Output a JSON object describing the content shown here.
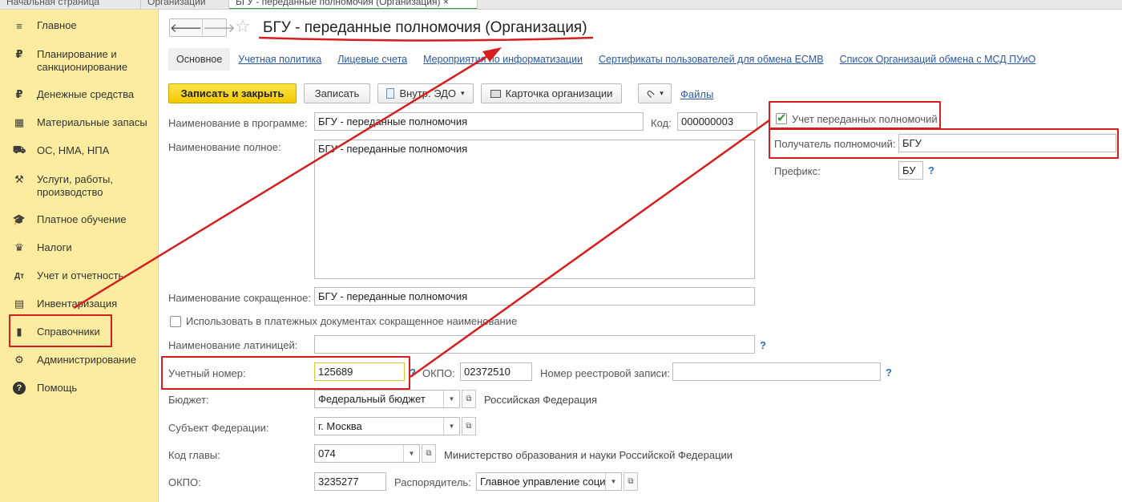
{
  "tabs": [
    {
      "label": "Начальная страница"
    },
    {
      "label": "Организации"
    },
    {
      "label": "БГУ - переданные полномочия (Организация)",
      "close": "×"
    }
  ],
  "sidebar": {
    "items": [
      {
        "label": "Главное",
        "icon": "menu-icon",
        "glyph": "≡"
      },
      {
        "label": "Планирование и санкционирование",
        "icon": "planning-icon",
        "glyph": "₽"
      },
      {
        "label": "Денежные средства",
        "icon": "ruble-coin-icon",
        "glyph": "₽"
      },
      {
        "label": "Материальные запасы",
        "icon": "grid-icon",
        "glyph": "▦"
      },
      {
        "label": "ОС, НМА, НПА",
        "icon": "truck-icon",
        "glyph": "⛟"
      },
      {
        "label": "Услуги, работы, производство",
        "icon": "tools-icon",
        "glyph": "⚒"
      },
      {
        "label": "Платное обучение",
        "icon": "graduation-cap-icon",
        "glyph": "🎓"
      },
      {
        "label": "Налоги",
        "icon": "emblem-icon",
        "glyph": "♛"
      },
      {
        "label": "Учет и отчетность",
        "icon": "accounting-icon",
        "glyph": "Дт"
      },
      {
        "label": "Инвентаризация",
        "icon": "calculator-icon",
        "glyph": "▤"
      },
      {
        "label": "Справочники",
        "icon": "book-icon",
        "glyph": "▮"
      },
      {
        "label": "Администрирование",
        "icon": "gear-icon",
        "glyph": "⚙"
      },
      {
        "label": "Помощь",
        "icon": "help-circle-icon",
        "glyph": "?"
      }
    ]
  },
  "header": {
    "back": "🡐",
    "forward": "🡒",
    "star": "☆",
    "title": "БГУ - переданные полномочия (Организация)"
  },
  "sections": [
    "Основное",
    "Учетная политика",
    "Лицевые счета",
    "Мероприятия по информатизации",
    "Сертификаты пользователей для обмена ЕСМВ",
    "Список Организаций обмена с МСД ПУиО"
  ],
  "toolbar": {
    "save_close": "Записать и закрыть",
    "save": "Записать",
    "edo": "Внутр. ЭДО",
    "card": "Карточка организации",
    "files": "Файлы",
    "arrow": "▾"
  },
  "form": {
    "name_program_label": "Наименование в программе:",
    "name_program": "БГУ - переданные полномочия",
    "code_label": "Код:",
    "code": "000000003",
    "name_full_label": "Наименование полное:",
    "name_full": "БГУ - переданные полномочия",
    "name_short_label": "Наименование сокращенное:",
    "name_short": "БГУ - переданные полномочия",
    "use_short_label": "Использовать в платежных документах сокращенное наименование",
    "latin_label": "Наименование латиницей:",
    "latin": "",
    "reg_num_label": "Учетный номер:",
    "reg_num": "125689",
    "okpo_label": "ОКПО:",
    "okpo": "02372510",
    "registry_label": "Номер реестровой записи:",
    "registry": "",
    "budget_label": "Бюджет:",
    "budget": "Федеральный бюджет",
    "budget_desc": "Российская Федерация",
    "subject_label": "Субъект Федерации:",
    "subject": "г. Москва",
    "chapter_label": "Код главы:",
    "chapter": "074",
    "chapter_desc": "Министерство образования и науки Российской Федерации",
    "okpo2_label": "ОКПО:",
    "okpo2": "3235277",
    "manager_label": "Распорядитель:",
    "manager": "Главное управление соци",
    "delegated_label": "Учет переданных полномочий",
    "recipient_label": "Получатель полномочий:",
    "recipient": "БГУ",
    "prefix_label": "Префикс:",
    "prefix": "БУ",
    "help": "?",
    "open": "⧉"
  },
  "colors": {
    "sidebar_bg": "#fbeca0",
    "primary_button": "#f2c900",
    "link": "#2a58a8",
    "annotation": "#d71e1e"
  }
}
